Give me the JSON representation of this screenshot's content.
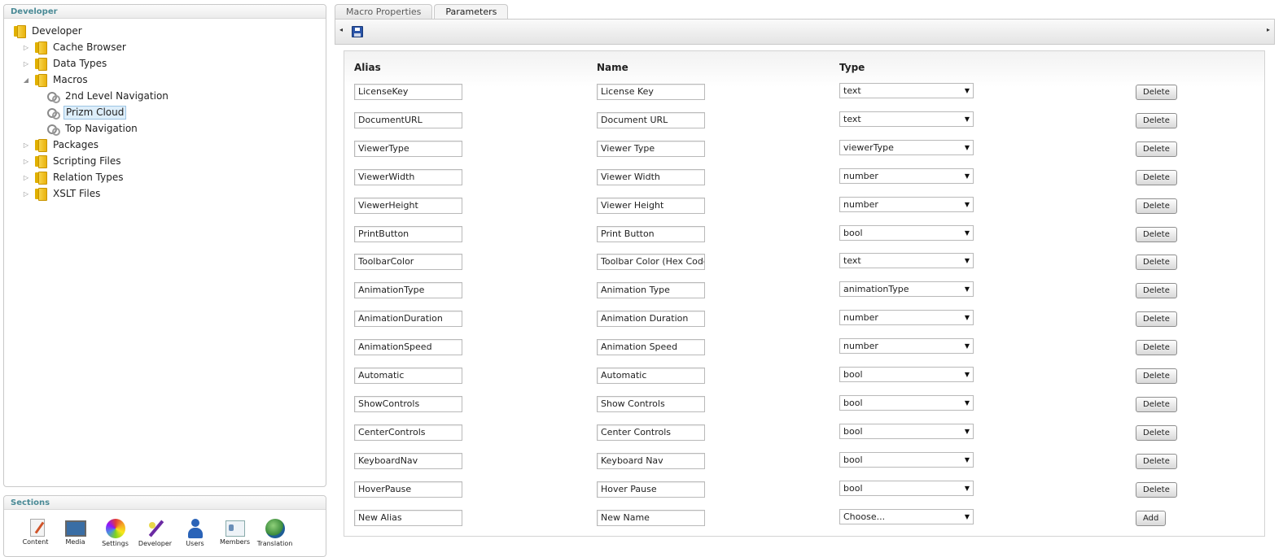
{
  "tree": {
    "header": "Developer",
    "items": [
      {
        "label": "Developer",
        "icon": "folder-icon",
        "arrow": ""
      },
      {
        "label": "Cache Browser",
        "icon": "folder-icon",
        "arrow": "▷"
      },
      {
        "label": "Data Types",
        "icon": "folder-icon",
        "arrow": "▷"
      },
      {
        "label": "Macros",
        "icon": "folder-icon",
        "arrow": "◢"
      },
      {
        "label": "2nd Level Navigation",
        "icon": "macro-gear-icon",
        "arrow": ""
      },
      {
        "label": "Prizm Cloud",
        "icon": "macro-gear-icon",
        "arrow": "",
        "selected": true
      },
      {
        "label": "Top Navigation",
        "icon": "macro-gear-icon",
        "arrow": ""
      },
      {
        "label": "Packages",
        "icon": "folder-icon",
        "arrow": "▷"
      },
      {
        "label": "Scripting Files",
        "icon": "folder-icon",
        "arrow": "▷"
      },
      {
        "label": "Relation Types",
        "icon": "folder-icon",
        "arrow": "▷"
      },
      {
        "label": "XSLT Files",
        "icon": "folder-icon",
        "arrow": "▷"
      }
    ]
  },
  "sections": {
    "header": "Sections",
    "items": [
      {
        "label": "Content",
        "icon": "content-icon"
      },
      {
        "label": "Media",
        "icon": "media-icon"
      },
      {
        "label": "Settings",
        "icon": "settings-icon"
      },
      {
        "label": "Developer",
        "icon": "developer-icon"
      },
      {
        "label": "Users",
        "icon": "users-icon"
      },
      {
        "label": "Members",
        "icon": "members-icon"
      },
      {
        "label": "Translation",
        "icon": "translation-icon"
      }
    ]
  },
  "tabs": [
    {
      "label": "Macro Properties",
      "active": false
    },
    {
      "label": "Parameters",
      "active": true
    }
  ],
  "toolbar": {
    "left_arrow": "◂",
    "right_arrow": "▸",
    "save_icon": "save-icon"
  },
  "params": {
    "headers": {
      "alias": "Alias",
      "name": "Name",
      "type": "Type"
    },
    "delete_label": "Delete",
    "rows": [
      {
        "alias": "LicenseKey",
        "name": "License Key",
        "type": "text"
      },
      {
        "alias": "DocumentURL",
        "name": "Document URL",
        "type": "text"
      },
      {
        "alias": "ViewerType",
        "name": "Viewer Type",
        "type": "viewerType"
      },
      {
        "alias": "ViewerWidth",
        "name": "Viewer Width",
        "type": "number"
      },
      {
        "alias": "ViewerHeight",
        "name": "Viewer Height",
        "type": "number"
      },
      {
        "alias": "PrintButton",
        "name": "Print Button",
        "type": "bool"
      },
      {
        "alias": "ToolbarColor",
        "name": "Toolbar Color (Hex Code)",
        "type": "text"
      },
      {
        "alias": "AnimationType",
        "name": "Animation Type",
        "type": "animationType"
      },
      {
        "alias": "AnimationDuration",
        "name": "Animation Duration",
        "type": "number"
      },
      {
        "alias": "AnimationSpeed",
        "name": "Animation Speed",
        "type": "number"
      },
      {
        "alias": "Automatic",
        "name": "Automatic",
        "type": "bool"
      },
      {
        "alias": "ShowControls",
        "name": "Show Controls",
        "type": "bool"
      },
      {
        "alias": "CenterControls",
        "name": "Center Controls",
        "type": "bool"
      },
      {
        "alias": "KeyboardNav",
        "name": "Keyboard Nav",
        "type": "bool"
      },
      {
        "alias": "HoverPause",
        "name": "Hover Pause",
        "type": "bool"
      }
    ],
    "new_row": {
      "alias": "New Alias",
      "name": "New Name",
      "type": "Choose...",
      "add_label": "Add"
    }
  }
}
